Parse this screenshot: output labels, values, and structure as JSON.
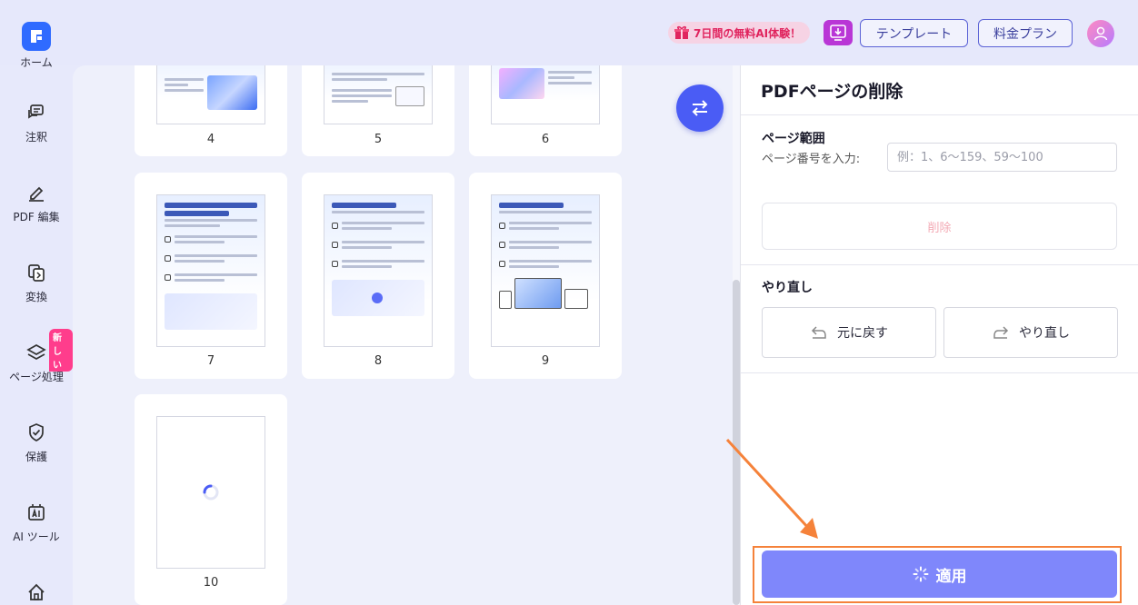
{
  "topbar": {
    "promo_label": "7日間の無料AI体験！",
    "template_label": "テンプレート",
    "plan_label": "料金プラン"
  },
  "sidebar": {
    "items": [
      {
        "label": "ホーム",
        "icon": "home-logo-icon"
      },
      {
        "label": "注釈",
        "icon": "comment-icon"
      },
      {
        "label": "PDF 編集",
        "icon": "pen-icon"
      },
      {
        "label": "変換",
        "icon": "convert-icon"
      },
      {
        "label": "ページ処理",
        "icon": "layers-icon"
      },
      {
        "label": "保護",
        "icon": "shield-icon"
      },
      {
        "label": "AI ツール",
        "icon": "ai-tool-icon"
      }
    ],
    "new_badge": "新しい"
  },
  "pages": [
    {
      "num": "4"
    },
    {
      "num": "5"
    },
    {
      "num": "6"
    },
    {
      "num": "7"
    },
    {
      "num": "8"
    },
    {
      "num": "9"
    },
    {
      "num": "10"
    }
  ],
  "panel": {
    "title": "PDFページの削除",
    "range_section": "ページ範囲",
    "range_label": "ページ番号を入力:",
    "range_placeholder": "例：1、6～159、59～100",
    "delete_label": "削除",
    "redo_section": "やり直し",
    "undo_label": "元に戻す",
    "redo_label": "やり直し",
    "apply_label": "適用"
  },
  "colors": {
    "accent": "#4a5cf5",
    "apply_button": "#7f87fb",
    "annotation": "#f5823a",
    "promo_text": "#e0245e"
  }
}
